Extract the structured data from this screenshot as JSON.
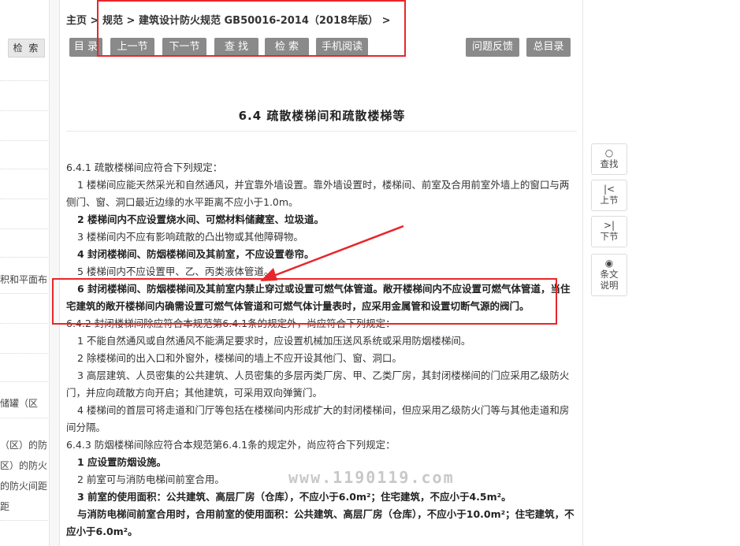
{
  "sidebar": {
    "search_label": "检 索",
    "items": [
      "积和平面布",
      "储罐（区",
      "（区）的防",
      "区）的防火",
      "的防火间距",
      "距"
    ]
  },
  "breadcrumb": {
    "home": "主页",
    "sep": ">",
    "level1": "规范",
    "level2": "建筑设计防火规范 GB50016-2014（2018年版）"
  },
  "toolbar": {
    "catalog": "目 录",
    "prev": "上一节",
    "next": "下一节",
    "find": "查 找",
    "search": "检 索",
    "mobile": "手机阅读",
    "feedback": "问题反馈",
    "toc": "总目录"
  },
  "page": {
    "title": "6.4 疏散楼梯间和疏散楼梯等"
  },
  "content": {
    "s641": "6.4.1 疏散楼梯间应符合下列规定：",
    "s641_1": "1 楼梯间应能天然采光和自然通风，并宜靠外墙设置。靠外墙设置时，楼梯间、前室及合用前室外墙上的窗口与两侧门、窗、洞口最近边缘的水平距离不应小于1.0m。",
    "s641_2": "2 楼梯间内不应设置烧水间、可燃材料储藏室、垃圾道。",
    "s641_3": "3 楼梯间内不应有影响疏散的凸出物或其他障碍物。",
    "s641_4": "4 封闭楼梯间、防烟楼梯间及其前室，不应设置卷帘。",
    "s641_5": "5 楼梯间内不应设置甲、乙、丙类液体管道。",
    "s641_6": "6 封闭楼梯间、防烟楼梯间及其前室内禁止穿过或设置可燃气体管道。敞开楼梯间内不应设置可燃气体管道，当住宅建筑的敞开楼梯间内确需设置可燃气体管道和可燃气体计量表时，应采用金属管和设置切断气源的阀门。",
    "s642": "6.4.2 封闭楼梯间除应符合本规范第6.4.1条的规定外，尚应符合下列规定：",
    "s642_1": "1 不能自然通风或自然通风不能满足要求时，应设置机械加压送风系统或采用防烟楼梯间。",
    "s642_2": "2 除楼梯间的出入口和外窗外，楼梯间的墙上不应开设其他门、窗、洞口。",
    "s642_3": "3 高层建筑、人员密集的公共建筑、人员密集的多层丙类厂房、甲、乙类厂房，其封闭楼梯间的门应采用乙级防火门，并应向疏散方向开启；其他建筑，可采用双向弹簧门。",
    "s642_4": "4 楼梯间的首层可将走道和门厅等包括在楼梯间内形成扩大的封闭楼梯间，但应采用乙级防火门等与其他走道和房间分隔。",
    "s643": "6.4.3 防烟楼梯间除应符合本规范第6.4.1条的规定外，尚应符合下列规定：",
    "s643_1": "1 应设置防烟设施。",
    "s643_2": "2 前室可与消防电梯间前室合用。",
    "s643_3": "3 前室的使用面积：公共建筑、高层厂房（仓库），不应小于6.0m²；住宅建筑，不应小于4.5m²。",
    "s643_3b": "与消防电梯间前室合用时，合用前室的使用面积：公共建筑、高层厂房（仓库），不应小于10.0m²；住宅建筑，不应小于6.0m²。"
  },
  "watermark": "www.1190119.com",
  "right_nav": {
    "find_label": "查找",
    "prev_label": "上节",
    "next_label": "下节",
    "explain_label": "条文说明",
    "find_icon": "○",
    "prev_icon": "|<",
    "next_icon": ">|",
    "explain_icon": "◉"
  },
  "colors": {
    "annotation": "#e8262a",
    "button_bg": "#8a8a8a"
  }
}
